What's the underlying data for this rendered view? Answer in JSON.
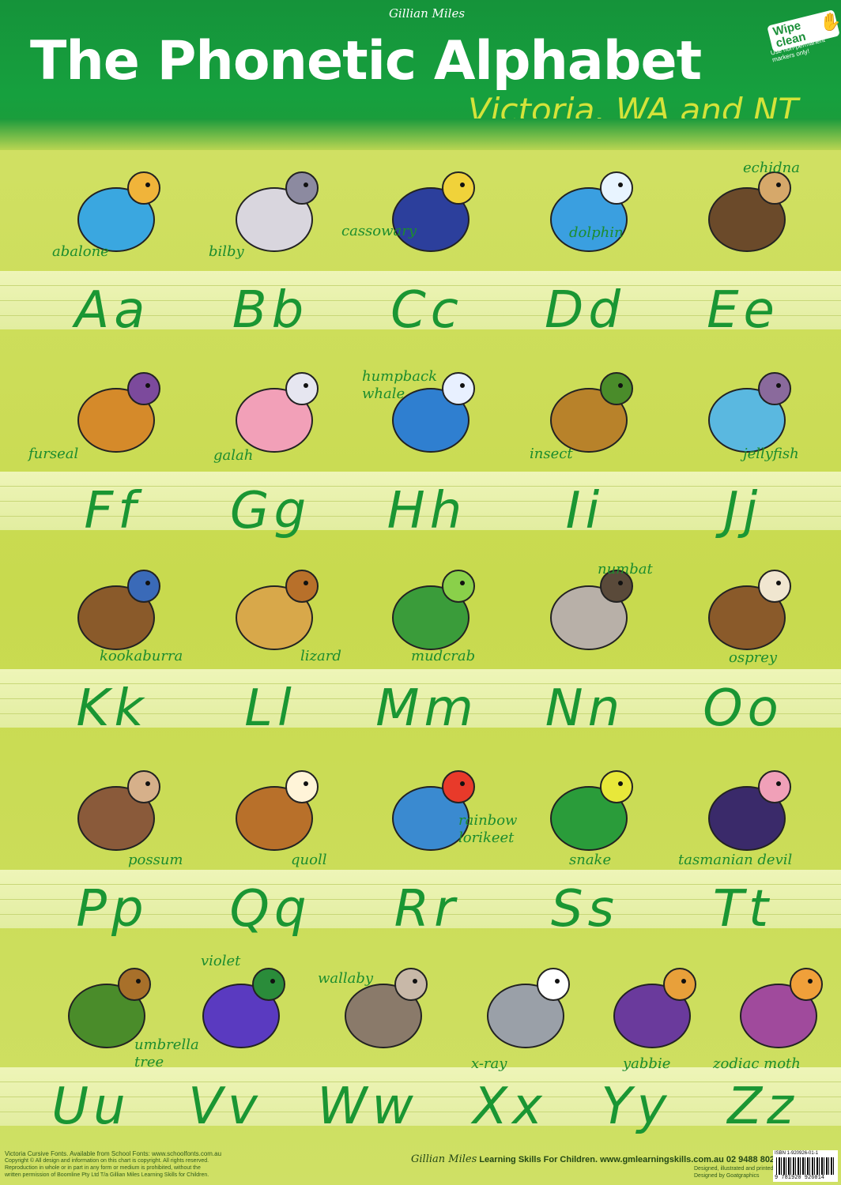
{
  "header": {
    "brand": "Gillian Miles",
    "title": "The Phonetic Alphabet",
    "subtitle": "Victoria, WA and NT",
    "badge": "Wipe clean",
    "badge_note": "Use non-permanent markers only!"
  },
  "colors": {
    "header_green": "#16a03e",
    "letter_green": "#1a9633",
    "background": "#ccdc56"
  },
  "rows": [
    [
      {
        "letter": "Aa",
        "word": [
          "abalone"
        ],
        "icon": "abalone-icon"
      },
      {
        "letter": "Bb",
        "word": [
          "bilby"
        ],
        "icon": "bilby-icon"
      },
      {
        "letter": "Cc",
        "word": [
          "cassowary"
        ],
        "icon": "cassowary-icon"
      },
      {
        "letter": "Dd",
        "word": [
          "dolphin"
        ],
        "icon": "dolphin-icon"
      },
      {
        "letter": "Ee",
        "word": [
          "echidna"
        ],
        "icon": "echidna-icon"
      }
    ],
    [
      {
        "letter": "Ff",
        "word": [
          "furseal"
        ],
        "icon": "furseal-icon"
      },
      {
        "letter": "Gg",
        "word": [
          "galah"
        ],
        "icon": "galah-icon"
      },
      {
        "letter": "Hh",
        "word": [
          "humpback",
          "whale"
        ],
        "icon": "humpback-whale-icon"
      },
      {
        "letter": "Ii",
        "word": [
          "insect"
        ],
        "icon": "insect-icon"
      },
      {
        "letter": "Jj",
        "word": [
          "jellyfish"
        ],
        "icon": "jellyfish-icon"
      }
    ],
    [
      {
        "letter": "Kk",
        "word": [
          "kookaburra"
        ],
        "icon": "kookaburra-icon"
      },
      {
        "letter": "Ll",
        "word": [
          "lizard"
        ],
        "icon": "lizard-icon"
      },
      {
        "letter": "Mm",
        "word": [
          "mudcrab"
        ],
        "icon": "mudcrab-icon"
      },
      {
        "letter": "Nn",
        "word": [
          "numbat"
        ],
        "icon": "numbat-icon"
      },
      {
        "letter": "Oo",
        "word": [
          "osprey"
        ],
        "icon": "osprey-icon"
      }
    ],
    [
      {
        "letter": "Pp",
        "word": [
          "possum"
        ],
        "icon": "possum-icon"
      },
      {
        "letter": "Qq",
        "word": [
          "quoll"
        ],
        "icon": "quoll-icon"
      },
      {
        "letter": "Rr",
        "word": [
          "rainbow",
          "lorikeet"
        ],
        "icon": "rainbow-lorikeet-icon"
      },
      {
        "letter": "Ss",
        "word": [
          "snake"
        ],
        "icon": "snake-icon"
      },
      {
        "letter": "Tt",
        "word": [
          "tasmanian devil"
        ],
        "icon": "tasmanian-devil-icon"
      }
    ],
    [
      {
        "letter": "Uu",
        "word": [
          "umbrella",
          "tree"
        ],
        "icon": "umbrella-tree-icon"
      },
      {
        "letter": "Vv",
        "word": [
          "violet"
        ],
        "icon": "violet-icon"
      },
      {
        "letter": "Ww",
        "word": [
          "wallaby"
        ],
        "icon": "wallaby-icon"
      },
      {
        "letter": "Xx",
        "word": [
          "x-ray"
        ],
        "icon": "x-ray-koala-icon"
      },
      {
        "letter": "Yy",
        "word": [
          "yabbie"
        ],
        "icon": "yabbie-icon"
      },
      {
        "letter": "Zz",
        "word": [
          "zodiac moth"
        ],
        "icon": "zodiac-moth-icon"
      }
    ]
  ],
  "footer": {
    "fonts_note": "Victoria Cursive Fonts. Available from School Fonts: www.schoolfonts.com.au",
    "copyright_1": "Copyright ©   All design and information on this chart is copyright. All rights reserved.",
    "copyright_2": "Reproduction in whole or in part in any form or medium is prohibited, without the",
    "copyright_3": "written permission of Boomline Pty Ltd T/a Gillian Miles Learning Skills for Children.",
    "brand": "Gillian Miles",
    "tagline": "Learning Skills For Children.  www.gmlearningskills.com.au   02 9488 8020",
    "designed": "Designed, illustrated and printed in Australia.",
    "designed_by": "Designed by Goatgraphics",
    "isbn": "ISBN 1-920926-01-1",
    "barcode_number": "9 781920 926014"
  }
}
